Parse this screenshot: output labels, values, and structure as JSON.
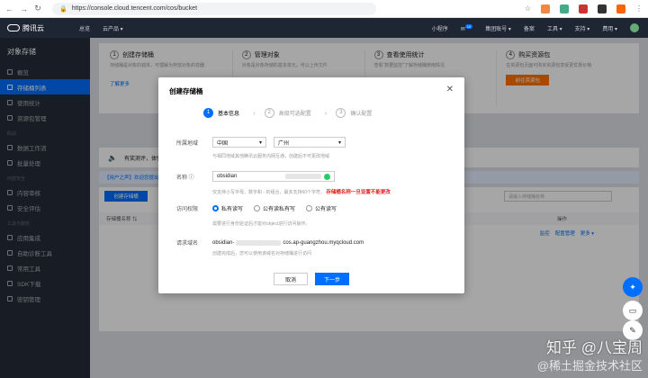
{
  "browser": {
    "url": "https://console.cloud.tencent.com/cos/bucket",
    "lock": "🔒"
  },
  "topbar": {
    "brand": "腾讯云",
    "home": "总览",
    "products": "云产品 ▾",
    "mini": "小程序",
    "badge": "10",
    "group": "集团账号 ▾",
    "icp": "备案",
    "tools": "工具 ▾",
    "support": "支持 ▾",
    "fees": "费用 ▾"
  },
  "sidebar": {
    "title": "对象存储",
    "items": [
      {
        "label": "概览"
      },
      {
        "label": "存储桶列表"
      },
      {
        "label": "使用统计"
      },
      {
        "label": "资源包管理"
      },
      {
        "label": "数据工作流"
      },
      {
        "label": "批量处理"
      },
      {
        "label": "内容审核"
      },
      {
        "label": "安全评估"
      },
      {
        "label": "应用集成"
      },
      {
        "label": "自助诊断工具"
      },
      {
        "label": "常用工具"
      },
      {
        "label": "SDK下载"
      },
      {
        "label": "密钥管理"
      }
    ],
    "groups": [
      "码站",
      "内容安全",
      "工具与服务"
    ]
  },
  "cards": [
    {
      "num": "1",
      "title": "创建存储桶",
      "desc": "存储桶是对象的载体，可理解为存放对象的容器",
      "link": "了解更多"
    },
    {
      "num": "2",
      "title": "管理对象",
      "desc": "对象是对象存储的基本单元，可以上传文件",
      "link": ""
    },
    {
      "num": "3",
      "title": "查看使用统计",
      "desc": "查看“数据监控”了解存储桶使用情况",
      "link": ""
    },
    {
      "num": "4",
      "title": "购买资源包",
      "desc": "在资源包页面可购买资源包享受更优惠价格",
      "button": "前往资源包"
    }
  ],
  "notice": {
    "text": "有奖测评，体验对象存储"
  },
  "banner": {
    "text": "【用户之声】欢迎您提出宝贵意见"
  },
  "table": {
    "create": "创建存储桶",
    "search_placeholder": "请输入存储桶名称",
    "col_name": "存储桶名称 ⇅",
    "col_op": "操作",
    "act1": "监控",
    "act2": "配置管理",
    "act3": "更多 ▾"
  },
  "modal": {
    "title": "创建存储桶",
    "close": "✕",
    "steps": [
      {
        "n": "1",
        "label": "基本信息"
      },
      {
        "n": "2",
        "label": "高级可选配置"
      },
      {
        "n": "3",
        "label": "确认配置"
      }
    ],
    "region_label": "所属地域",
    "region1": "中国",
    "region2": "广州",
    "region_hint": "与相同地域其他腾讯云服务内网互通，创建后不可更改地域",
    "name_label": "名称 ⓘ",
    "name_value": "obsidian",
    "name_hint": "仅支持小写字母、数字和 - 的组合，最多支持60个字符。",
    "name_warn": "存储桶名称一旦设置不能更改",
    "acl_label": "访问权限",
    "acl": [
      "私有读写",
      "公有读私有写",
      "公有读写"
    ],
    "acl_hint": "需要进行身份验证后才能对object进行访问操作。",
    "domain_label": "请求域名",
    "domain_prefix": "obsidian-",
    "domain_suffix": "cos.ap-guangzhou.myqcloud.com",
    "domain_hint": "创建完成后，您可以使用该域名对存储桶进行访问",
    "cancel": "取消",
    "next": "下一步"
  },
  "watermark": {
    "line1": "知乎 @八宝周",
    "line2": "@稀土掘金技术社区"
  }
}
